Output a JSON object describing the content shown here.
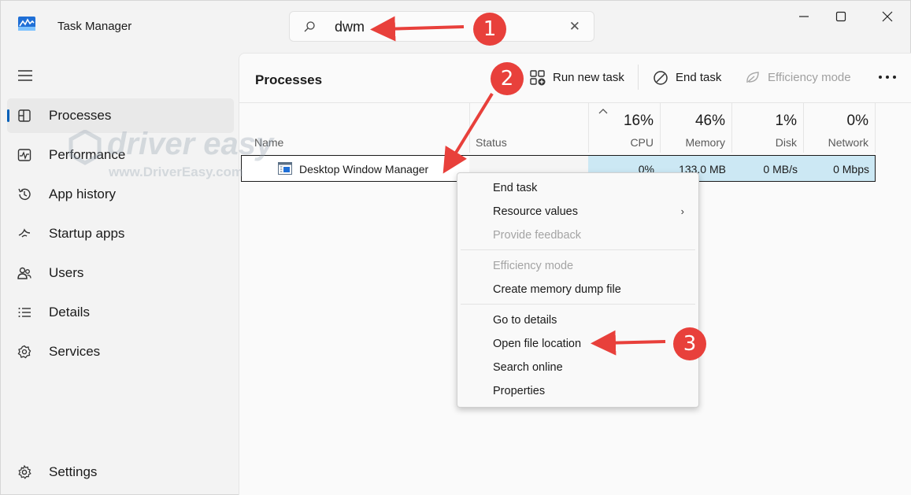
{
  "window": {
    "title": "Task Manager",
    "controls": {
      "minimize": "minimize",
      "maximize": "maximize",
      "close": "close"
    }
  },
  "search": {
    "value": "dwm",
    "clear_glyph": "✕"
  },
  "sidebar": {
    "menu_icon": "hamburger-icon",
    "items": [
      {
        "label": "Processes",
        "icon": "processes-icon",
        "active": true
      },
      {
        "label": "Performance",
        "icon": "performance-icon"
      },
      {
        "label": "App history",
        "icon": "history-icon"
      },
      {
        "label": "Startup apps",
        "icon": "startup-icon"
      },
      {
        "label": "Users",
        "icon": "users-icon"
      },
      {
        "label": "Details",
        "icon": "details-icon"
      },
      {
        "label": "Services",
        "icon": "services-icon"
      }
    ],
    "settings": {
      "label": "Settings",
      "icon": "gear-icon"
    }
  },
  "main": {
    "title": "Processes",
    "toolbar": {
      "run_new_task": "Run new task",
      "end_task": "End task",
      "efficiency_mode": "Efficiency mode",
      "more": "•••"
    },
    "columns": {
      "name": "Name",
      "status": "Status",
      "cpu": {
        "percent": "16%",
        "label": "CPU"
      },
      "memory": {
        "percent": "46%",
        "label": "Memory"
      },
      "disk": {
        "percent": "1%",
        "label": "Disk"
      },
      "network": {
        "percent": "0%",
        "label": "Network"
      }
    },
    "rows": [
      {
        "name": "Desktop Window Manager",
        "status": "",
        "cpu": "0%",
        "memory": "133.0 MB",
        "disk": "0 MB/s",
        "network": "0 Mbps"
      }
    ]
  },
  "context_menu": {
    "items": [
      {
        "label": "End task",
        "enabled": true
      },
      {
        "label": "Resource values",
        "enabled": true,
        "submenu": "›"
      },
      {
        "label": "Provide feedback",
        "enabled": false
      },
      {
        "label": "Efficiency mode",
        "enabled": false
      },
      {
        "label": "Create memory dump file",
        "enabled": true
      },
      {
        "label": "Go to details",
        "enabled": true
      },
      {
        "label": "Open file location",
        "enabled": true
      },
      {
        "label": "Search online",
        "enabled": true
      },
      {
        "label": "Properties",
        "enabled": true
      }
    ]
  },
  "watermark": {
    "main": "driver easy",
    "sub": "www.DriverEasy.com"
  },
  "annotations": {
    "badges": [
      "1",
      "2",
      "3"
    ],
    "color": "#e8403b"
  },
  "colors": {
    "accent": "#005fb8",
    "selection": "#cce8f4",
    "annotation": "#e8403b"
  }
}
